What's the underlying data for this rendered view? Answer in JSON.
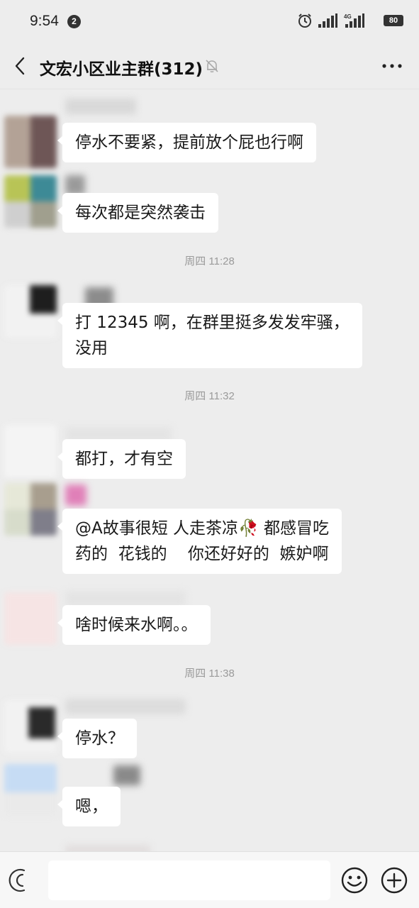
{
  "status_bar": {
    "time": "9:54",
    "notification_count": "2",
    "battery": "80",
    "icons": [
      "alarm-icon",
      "signal-icon",
      "signal-4g-icon",
      "battery-icon"
    ]
  },
  "header": {
    "title": "文宏小区业主群(312)",
    "icons": [
      "back-arrow-icon",
      "mute-bell-icon",
      "more-dots-icon"
    ]
  },
  "messages": [
    {
      "type": "message",
      "text": "停水不要紧，提前放个屁也行啊"
    },
    {
      "type": "message",
      "text": "每次都是突然袭击"
    },
    {
      "type": "timestamp",
      "text": "周四 11:28"
    },
    {
      "type": "message",
      "text": "打 12345 啊，在群里挺多发发牢骚，\n没用"
    },
    {
      "type": "timestamp",
      "text": "周四 11:32"
    },
    {
      "type": "message",
      "text": "都打，才有空"
    },
    {
      "type": "message",
      "text": "@A故事很短 人走茶凉🥀 都感冒吃\n药的  花钱的    你还好好的  嫉妒啊"
    },
    {
      "type": "message",
      "text": "啥时候来水啊。。"
    },
    {
      "type": "timestamp",
      "text": "周四 11:38"
    },
    {
      "type": "message",
      "text": "停水？"
    },
    {
      "type": "message",
      "text": "嗯，"
    }
  ],
  "input_bar": {
    "placeholder": "",
    "icons": [
      "voice-icon",
      "emoji-icon",
      "plus-icon"
    ]
  },
  "colors": {
    "background": "#ededed",
    "bubble": "#ffffff",
    "timestamp": "#9a9a9a"
  }
}
